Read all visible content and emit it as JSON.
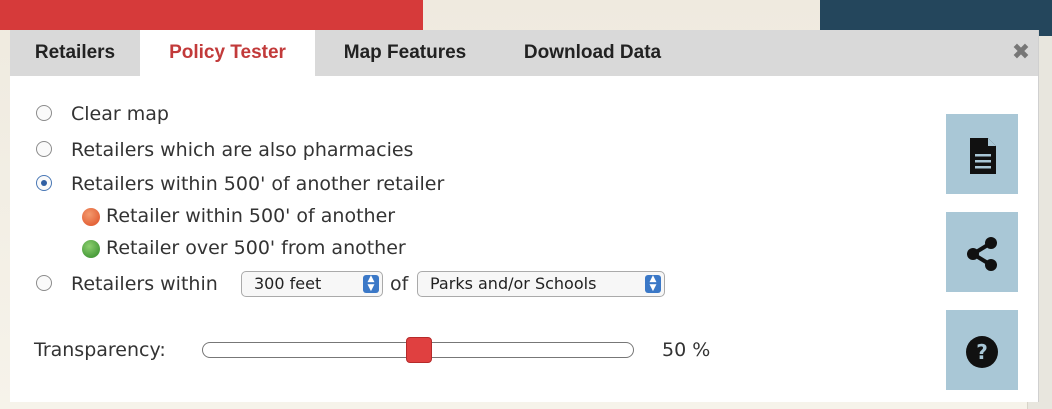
{
  "tabs": [
    {
      "label": "Retailers",
      "active": false
    },
    {
      "label": "Policy Tester",
      "active": true
    },
    {
      "label": "Map Features",
      "active": false
    },
    {
      "label": "Download Data",
      "active": false
    }
  ],
  "close_icon": "close-icon",
  "options": [
    {
      "label": "Clear map",
      "selected": false
    },
    {
      "label": "Retailers which are also pharmacies",
      "selected": false
    },
    {
      "label": "Retailers within 500' of another retailer",
      "selected": true
    },
    {
      "label": "Retailers within",
      "selected": false
    }
  ],
  "legend": [
    {
      "label": "Retailer within 500' of another",
      "color": "#e4643a"
    },
    {
      "label": "Retailer over 500' from another",
      "color": "#4a9d3c"
    }
  ],
  "distance_select": {
    "value": "300 feet"
  },
  "of_text": "of",
  "feature_select": {
    "value": "Parks and/or Schools"
  },
  "transparency": {
    "label": "Transparency:",
    "value_text": "50 %",
    "value": 0.5
  },
  "side_buttons": [
    {
      "icon": "document-icon"
    },
    {
      "icon": "share-icon"
    },
    {
      "icon": "help-icon"
    }
  ],
  "colors": {
    "accent_red": "#d63a3a",
    "header_blue": "#24465c",
    "button_blue": "#a9c7d6",
    "active_tab": "#c23a3a"
  }
}
